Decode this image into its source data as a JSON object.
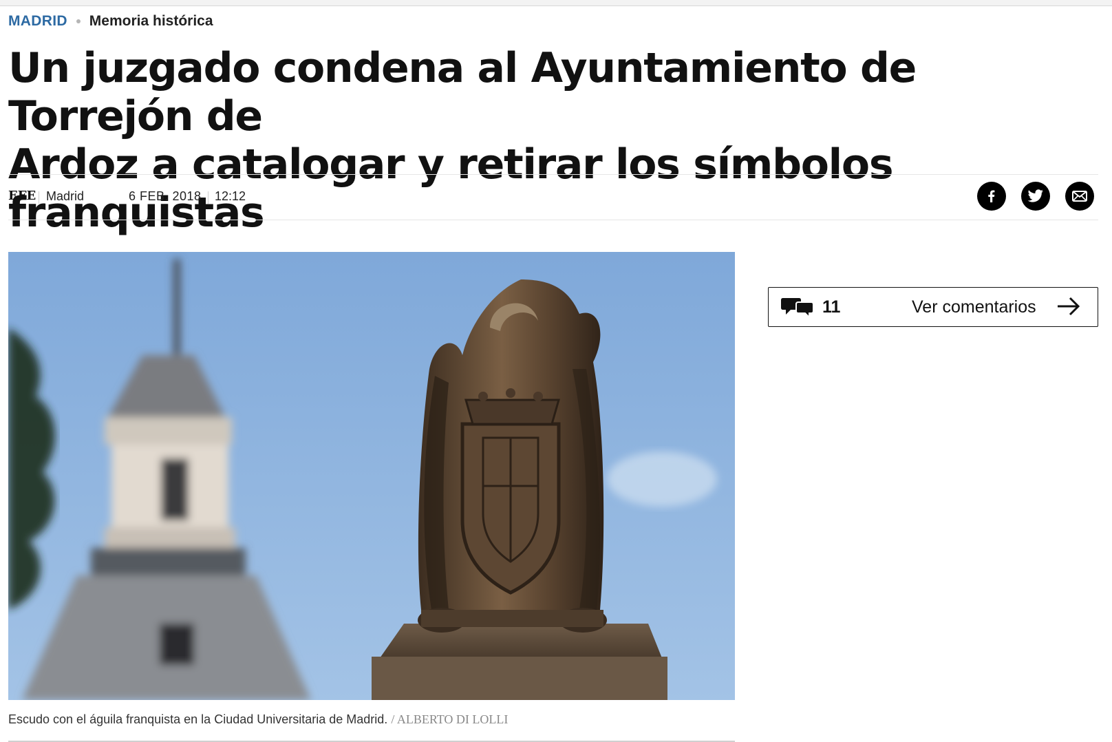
{
  "breadcrumb": {
    "section": "MADRID",
    "topic": "Memoria histórica"
  },
  "headline": {
    "line1": "Un juzgado condena al Ayuntamiento de Torrejón de",
    "line2": "Ardoz a catalogar y retirar los símbolos franquistas"
  },
  "byline": {
    "author": "EFE",
    "place": "Madrid",
    "date": "6 FEB. 2018",
    "time": "12:12"
  },
  "share": {
    "icons": [
      "facebook-icon",
      "twitter-icon",
      "mail-icon"
    ]
  },
  "photo": {
    "caption": "Escudo con el águila franquista en la Ciudad Universitaria de Madrid.",
    "credit": "/ ALBERTO DI LOLLI"
  },
  "comments": {
    "count": "11",
    "label": "Ver comentarios",
    "icon": "speech-bubbles-icon",
    "arrow_icon": "arrow-right-icon"
  },
  "colors": {
    "section_blue": "#2d6aa3",
    "text": "#111111",
    "rule": "#e6e6e6"
  }
}
